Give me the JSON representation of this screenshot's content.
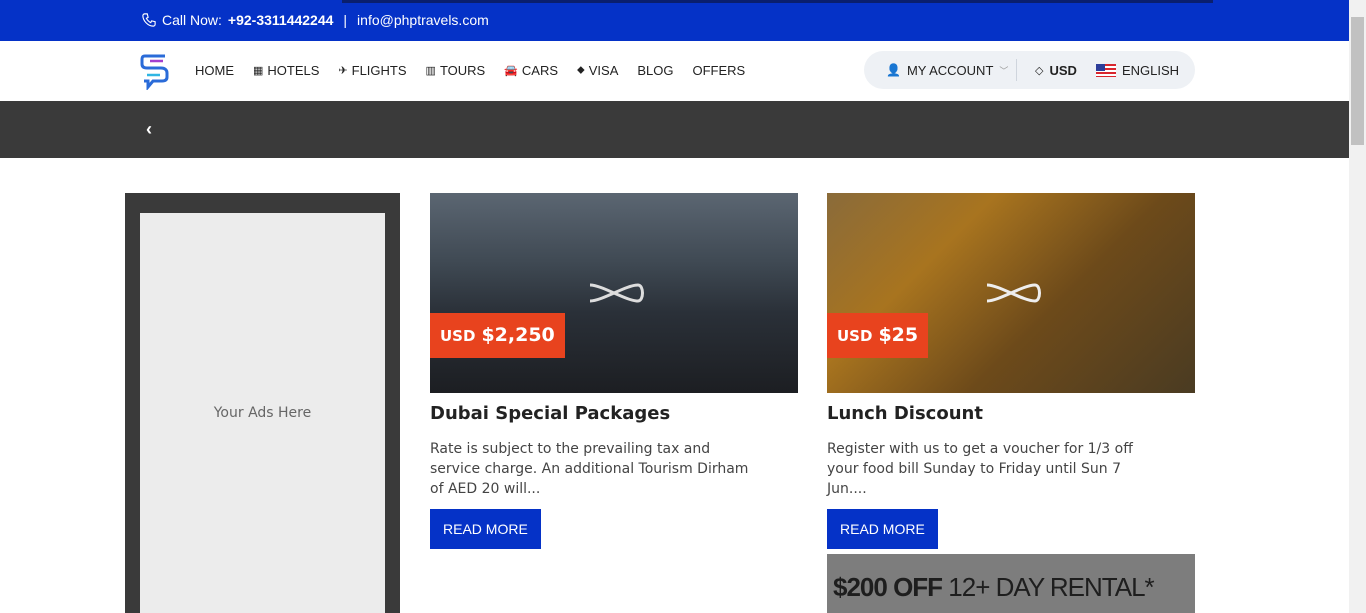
{
  "topbar": {
    "call_label": "Call Now:",
    "phone": "+92-3311442244",
    "separator": "|",
    "email": "info@phptravels.com"
  },
  "nav": {
    "items": [
      {
        "label": "HOME",
        "icon": ""
      },
      {
        "label": "HOTELS",
        "icon": "building-icon"
      },
      {
        "label": "FLIGHTS",
        "icon": "plane-icon"
      },
      {
        "label": "TOURS",
        "icon": "suitcase-icon"
      },
      {
        "label": "CARS",
        "icon": "car-icon"
      },
      {
        "label": "VISA",
        "icon": "tag-icon"
      },
      {
        "label": "BLOG",
        "icon": ""
      },
      {
        "label": "OFFERS",
        "icon": ""
      }
    ],
    "account": "MY ACCOUNT",
    "currency": "USD",
    "language": "ENGLISH"
  },
  "sidebar_ad": {
    "text": "Your Ads Here"
  },
  "offers": [
    {
      "currency": "USD",
      "price": "$2,250",
      "title": "Dubai Special Packages",
      "description": "Rate is subject to the prevailing tax and service charge. An additional Tourism Dirham of AED 20 will...",
      "button": "READ MORE"
    },
    {
      "currency": "USD",
      "price": "$25",
      "title": "Lunch Discount",
      "description": "Register with us to get a voucher for 1/3 off your food bill Sunday to Friday until Sun 7 Jun....",
      "button": "READ MORE"
    }
  ],
  "promo": {
    "bold": "$200 OFF",
    "rest": "12+ DAY RENTAL*"
  },
  "colors": {
    "primary": "#0532c7",
    "accent": "#e8431e",
    "dark": "#3a3a3a"
  }
}
